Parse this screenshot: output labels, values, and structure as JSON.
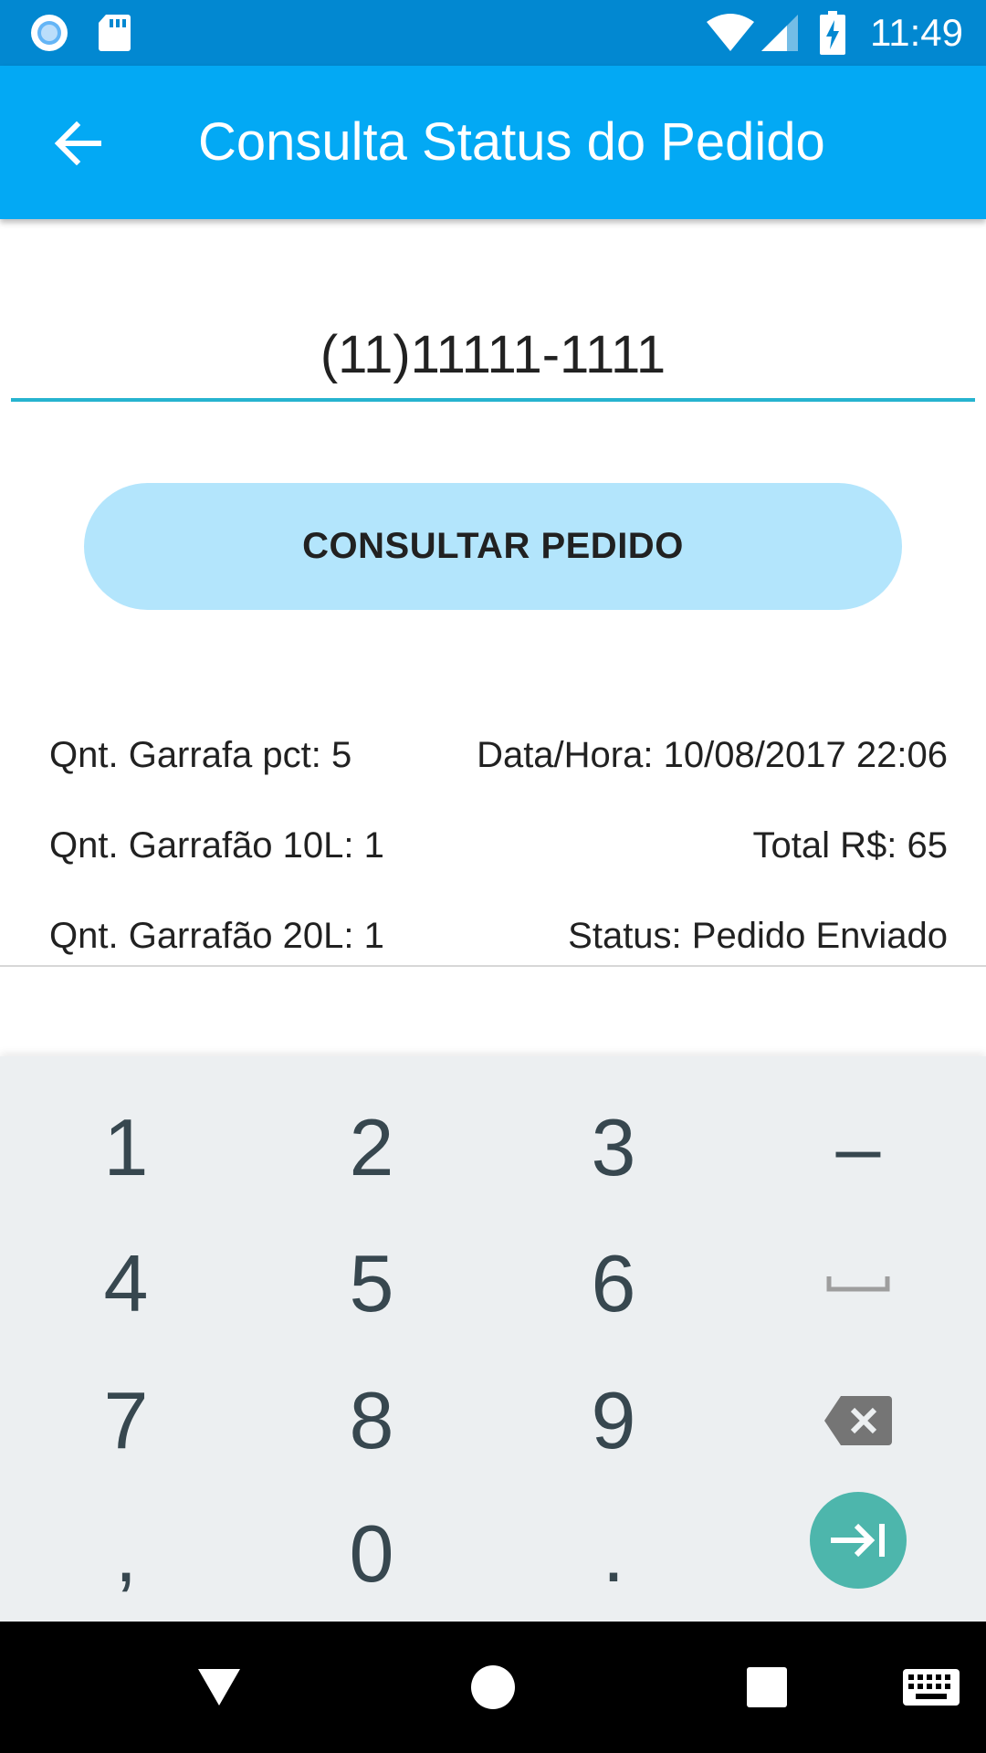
{
  "status_bar": {
    "time": "11:49",
    "left_icons": [
      "location-dot-icon",
      "sd-card-icon"
    ],
    "right_icons": [
      "wifi-icon",
      "cell-signal-icon",
      "battery-charging-icon"
    ]
  },
  "app_bar": {
    "title": "Consulta Status do Pedido",
    "back_icon": "arrow-back-icon",
    "color": "#03a9f4"
  },
  "phone_input": {
    "value": "(11)11111-1111"
  },
  "consult_button": {
    "label": "CONSULTAR PEDIDO",
    "color": "#b3e5fc"
  },
  "order_info": {
    "qty_garrafa_pct": "Qnt. Garrafa pct: 5",
    "datetime": "Data/Hora: 10/08/2017 22:06",
    "qty_garrafao_10l": "Qnt. Garrafão 10L: 1",
    "total": "Total R$: 65",
    "qty_garrafao_20l": "Qnt. Garrafão 20L: 1",
    "status": "Status: Pedido Enviado"
  },
  "keyboard": {
    "rows": [
      [
        "1",
        "2",
        "3",
        "–"
      ],
      [
        "4",
        "5",
        "6",
        "space"
      ],
      [
        "7",
        "8",
        "9",
        "backspace"
      ],
      [
        ",",
        "0",
        ".",
        "next"
      ]
    ],
    "labels": {
      "k1": "1",
      "k2": "2",
      "k3": "3",
      "k_dash": "–",
      "k4": "4",
      "k5": "5",
      "k6": "6",
      "k7": "7",
      "k8": "8",
      "k9": "9",
      "k_comma": ",",
      "k0": "0",
      "k_dot": "."
    },
    "accent_color": "#4db6ac"
  },
  "nav_bar": {
    "buttons": [
      "back-triangle-icon",
      "home-circle-icon",
      "recents-square-icon",
      "keyboard-icon"
    ]
  }
}
